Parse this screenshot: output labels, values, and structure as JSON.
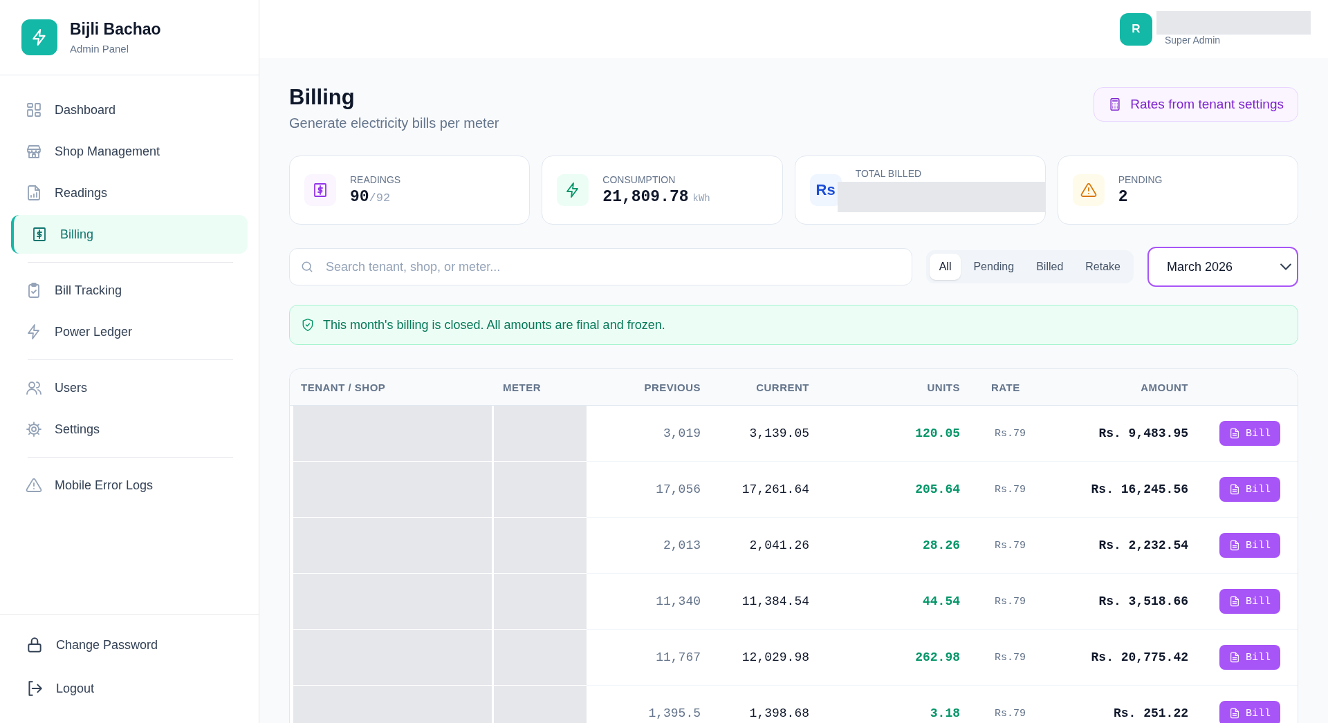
{
  "sidebar": {
    "brand": {
      "name": "Bijli Bachao",
      "subtitle": "Admin Panel"
    },
    "groups": [
      {
        "items": [
          {
            "label": "Dashboard",
            "selected": false
          },
          {
            "label": "Shop Management",
            "selected": false
          },
          {
            "label": "Readings",
            "selected": false
          },
          {
            "label": "Billing",
            "selected": true
          }
        ]
      },
      {
        "items": [
          {
            "label": "Bill Tracking",
            "selected": false
          },
          {
            "label": "Power Ledger",
            "selected": false
          }
        ]
      },
      {
        "items": [
          {
            "label": "Users",
            "selected": false
          },
          {
            "label": "Settings",
            "selected": false
          }
        ]
      },
      {
        "items": [
          {
            "label": "Mobile Error Logs",
            "selected": false
          }
        ]
      }
    ],
    "footer_items": [
      {
        "label": "Change Password"
      },
      {
        "label": "Logout"
      }
    ]
  },
  "topbar": {
    "avatar": "R",
    "role": "Super Admin"
  },
  "page": {
    "title": "Billing",
    "subtitle": "Generate electricity bills per meter",
    "rates_button": "Rates from tenant settings"
  },
  "stats": [
    {
      "kind": "readings",
      "label": "READINGS",
      "value": "90",
      "suffix": "/92"
    },
    {
      "kind": "consumption",
      "label": "CONSUMPTION",
      "value": "21,809.78",
      "suffix": "kWh"
    },
    {
      "kind": "billed",
      "label": "TOTAL BILLED",
      "icon_text": "Rs"
    },
    {
      "kind": "pending",
      "label": "PENDING",
      "value": "2"
    }
  ],
  "search": {
    "placeholder": "Search tenant, shop, or meter..."
  },
  "filters": [
    {
      "label": "All",
      "selected": true
    },
    {
      "label": "Pending",
      "selected": false
    },
    {
      "label": "Billed",
      "selected": false
    },
    {
      "label": "Retake",
      "selected": false
    }
  ],
  "month_select": {
    "value": "March 2026"
  },
  "notice": "This month's billing is closed. All amounts are final and frozen.",
  "table": {
    "columns": [
      "TENANT / SHOP",
      "METER",
      "PREVIOUS",
      "CURRENT",
      "UNITS",
      "RATE",
      "AMOUNT"
    ],
    "rows": [
      {
        "previous": "3,019",
        "current": "3,139.05",
        "units": "120.05",
        "rate": "Rs.79",
        "amount": "Rs. 9,483.95",
        "action": "Bill"
      },
      {
        "previous": "17,056",
        "current": "17,261.64",
        "units": "205.64",
        "rate": "Rs.79",
        "amount": "Rs. 16,245.56",
        "action": "Bill"
      },
      {
        "previous": "2,013",
        "current": "2,041.26",
        "units": "28.26",
        "rate": "Rs.79",
        "amount": "Rs. 2,232.54",
        "action": "Bill"
      },
      {
        "previous": "11,340",
        "current": "11,384.54",
        "units": "44.54",
        "rate": "Rs.79",
        "amount": "Rs. 3,518.66",
        "action": "Bill"
      },
      {
        "previous": "11,767",
        "current": "12,029.98",
        "units": "262.98",
        "rate": "Rs.79",
        "amount": "Rs. 20,775.42",
        "action": "Bill"
      },
      {
        "previous": "1,395.5",
        "current": "1,398.68",
        "units": "3.18",
        "rate": "Rs.79",
        "amount": "Rs. 251.22",
        "action": "Bill"
      }
    ]
  }
}
